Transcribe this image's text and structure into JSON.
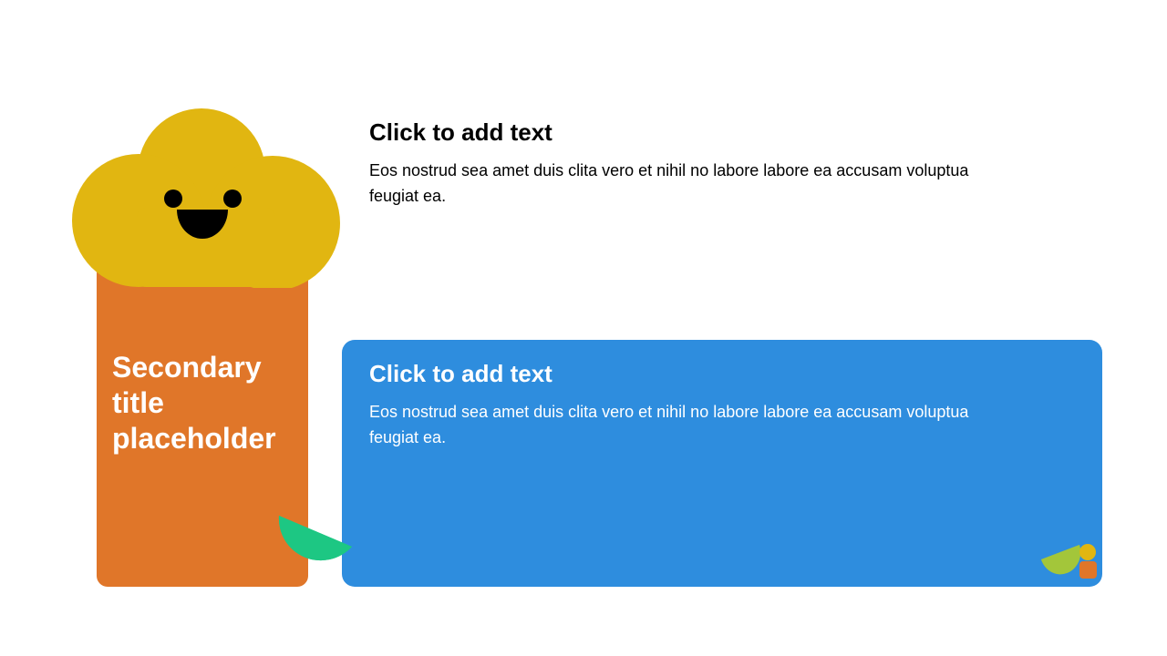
{
  "colors": {
    "orange": "#E07629",
    "yellow": "#E1B611",
    "blue": "#2E8DDE",
    "green": "#1DC783",
    "lime": "#A3C63A",
    "face": "#000000"
  },
  "sidebar": {
    "title": "Secondary title placeholder",
    "mascot_icon": "smiling-cloud-icon",
    "accent_icon": "green-leaf-icon"
  },
  "top_block": {
    "heading": "Click to add text",
    "body": "Eos nostrud sea amet duis clita vero et nihil no labore labore ea accusam voluptua feugiat ea."
  },
  "bottom_block": {
    "heading": "Click to add text",
    "body": "Eos nostrud sea amet duis clita vero et nihil no labore labore ea accusam voluptua feugiat ea.",
    "logo_icon": "mini-logo-icon"
  }
}
